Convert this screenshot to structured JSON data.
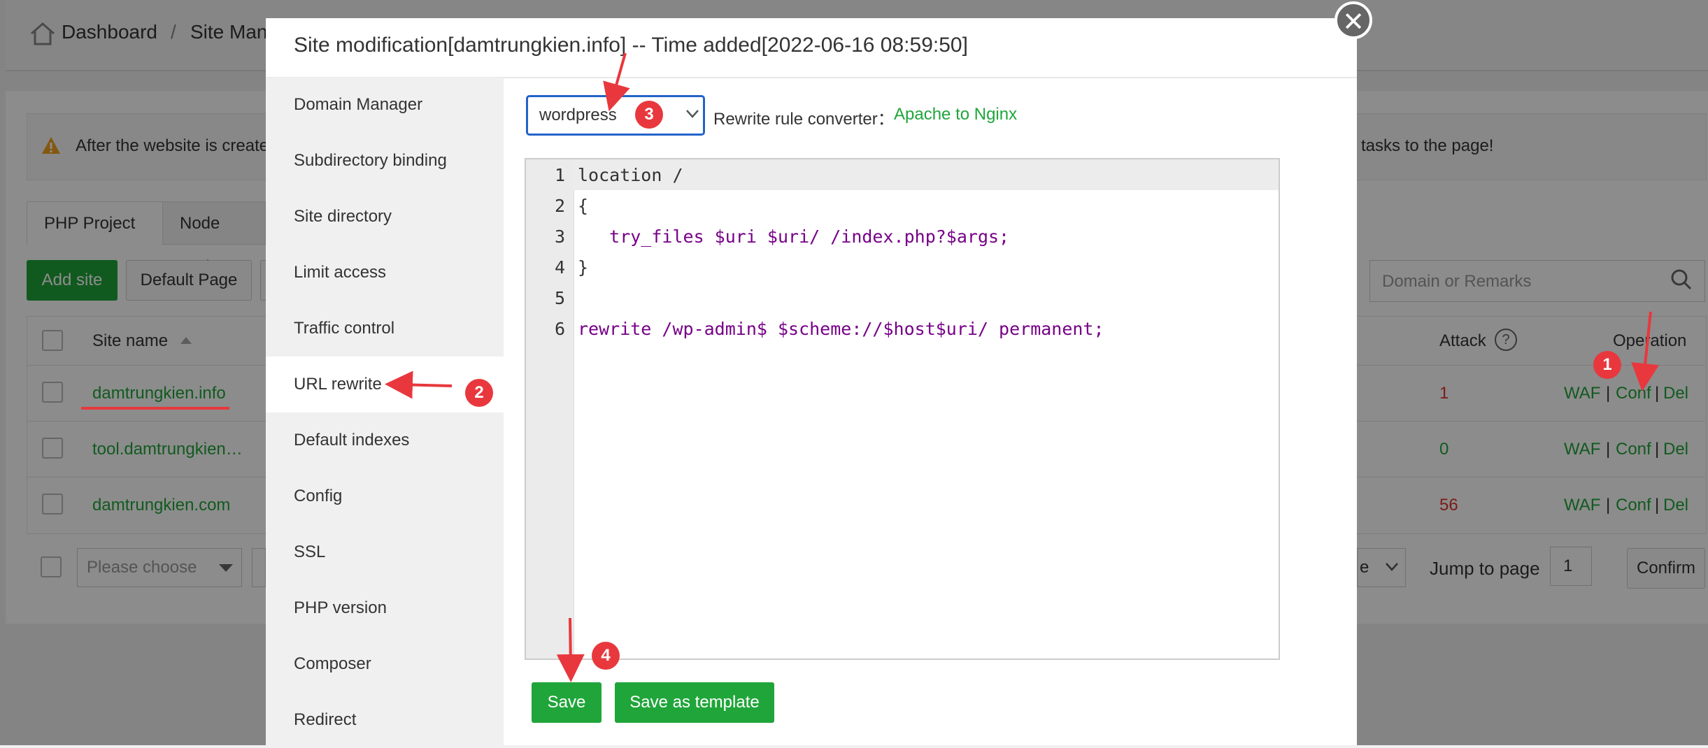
{
  "background": {
    "breadcrumb": {
      "home": "Dashboard",
      "separator": "/",
      "current": "Site Man"
    },
    "notice": {
      "text_left": "After the website is create",
      "text_right": "tasks to the page!"
    },
    "tabs": [
      "PHP Project",
      "Node Proje"
    ],
    "toolbar": {
      "add_site": "Add site",
      "default_page": "Default Page",
      "search_placeholder": "Domain or Remarks"
    },
    "table": {
      "headers": {
        "site_name": "Site name",
        "attack": "Attack",
        "operation": "Operation"
      },
      "rows": [
        {
          "site": "damtrungkien.info",
          "attack": "1",
          "waf": "WAF",
          "conf": "Conf",
          "del": "Del"
        },
        {
          "site": "tool.damtrungkien…",
          "attack": "0",
          "waf": "WAF",
          "conf": "Conf",
          "del": "Del"
        },
        {
          "site": "damtrungkien.com",
          "attack": "56",
          "waf": "WAF",
          "conf": "Conf",
          "del": "Del"
        }
      ],
      "separator": "|"
    },
    "footer": {
      "please_choose": "Please choose",
      "page_size_partial": "e",
      "jump_label": "Jump to page",
      "jump_value": "1",
      "confirm": "Confirm"
    }
  },
  "modal": {
    "title": "Site modification[damtrungkien.info] -- Time added[2022-06-16 08:59:50]",
    "close": "✕",
    "nav": [
      "Domain Manager",
      "Subdirectory binding",
      "Site directory",
      "Limit access",
      "Traffic control",
      "URL rewrite",
      "Default indexes",
      "Config",
      "SSL",
      "PHP version",
      "Composer",
      "Redirect"
    ],
    "active_nav": "URL rewrite",
    "rewrite_select": {
      "value": "wordpress"
    },
    "converter": {
      "label": "Rewrite rule converter：",
      "link": "Apache to Nginx"
    },
    "code_lines": [
      "location /",
      "{",
      "   try_files $uri $uri/ /index.php?$args;",
      "}",
      "",
      "rewrite /wp-admin$ $scheme://$host$uri/ permanent;"
    ],
    "line_numbers": [
      "1",
      "2",
      "3",
      "4",
      "5",
      "6"
    ],
    "save": "Save",
    "save_template": "Save as template"
  },
  "annotations": [
    "1",
    "2",
    "3",
    "4"
  ],
  "colors": {
    "accent_green": "#20a53a",
    "annotation_red": "#e8383d",
    "select_border": "#2463c8"
  }
}
